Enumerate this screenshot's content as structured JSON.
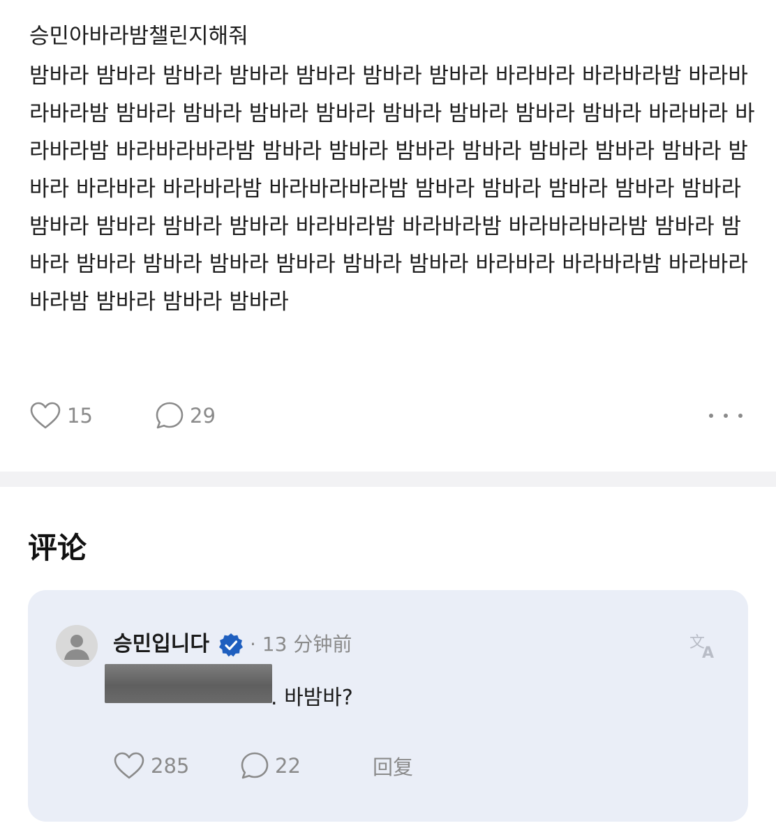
{
  "post": {
    "title": "승민아바라밤챌린지해줘",
    "body": "밤바라 밤바라 밤바라 밤바라 밤바라 밤바라 밤바라 바라바라 바라바라밤 바라바라바라밤 밤바라 밤바라 밤바라 밤바라 밤바라 밤바라 밤바라 밤바라 바라바라 바라바라밤 바라바라바라밤 밤바라 밤바라 밤바라 밤바라 밤바라 밤바라 밤바라 밤바라 바라바라 바라바라밤 바라바라바라밤 밤바라 밤바라 밤바라 밤바라 밤바라 밤바라 밤바라 밤바라 밤바라 바라바라밤 바라바라밤 바라바라바라밤 밤바라 밤바라 밤바라 밤바라 밤바라 밤바라 밤바라 밤바라 바라바라 바라바라밤 바라바라바라밤 밤바라 밤바라 밤바라",
    "like_count": "15",
    "comment_count": "29"
  },
  "comments": {
    "heading": "评论",
    "items": [
      {
        "author": "승민입니다",
        "meta": "· 13 分钟前",
        "text": ". 바밤바?",
        "like_count": "285",
        "reply_count": "22",
        "reply_label": "回复"
      }
    ]
  },
  "colors": {
    "text": "#1a1a1a",
    "muted": "#8a8a8a",
    "card_bg": "#eaeef7",
    "verified": "#1f5fbf"
  }
}
